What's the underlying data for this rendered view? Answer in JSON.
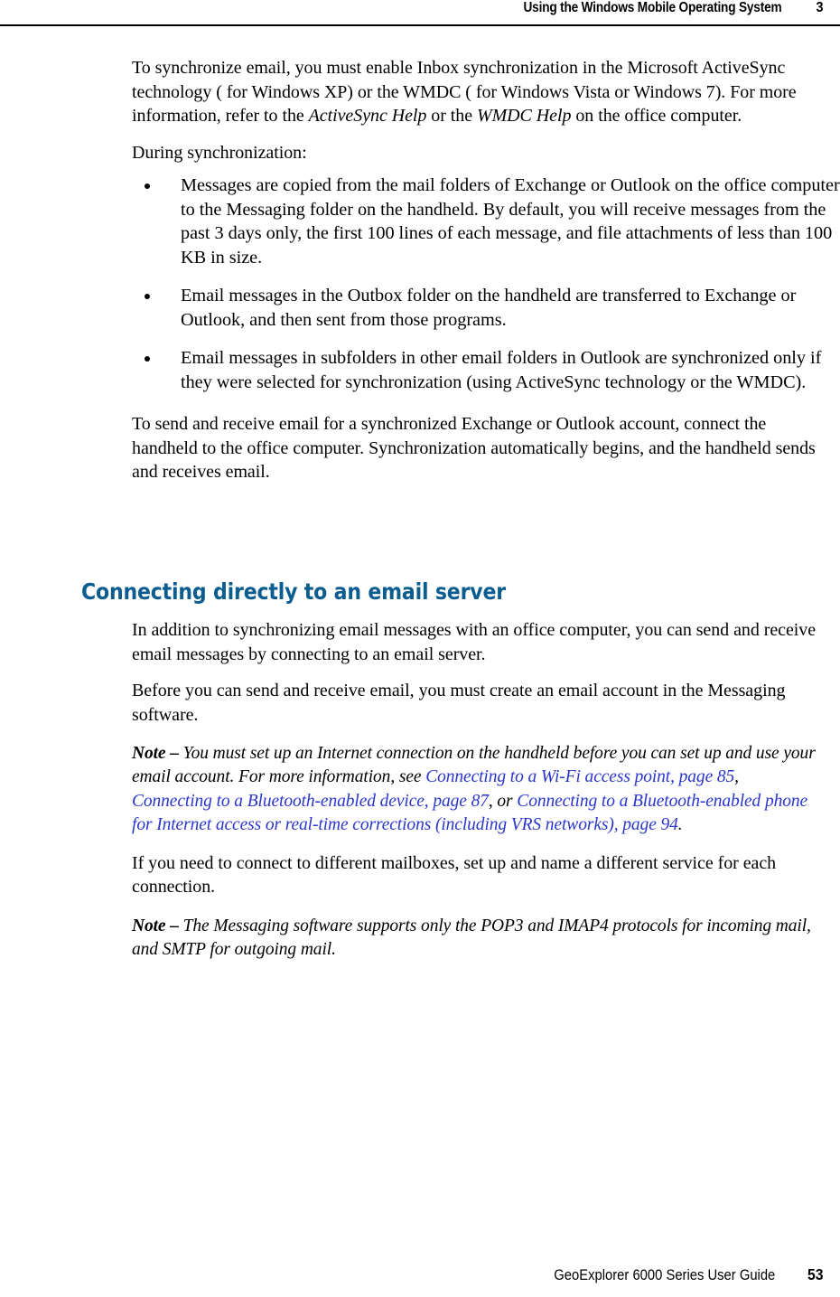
{
  "header": {
    "running_title": "Using the Windows Mobile Operating System",
    "chapter_number": "3"
  },
  "intro": {
    "paragraph_1_part_1": "To synchronize email, you must enable Inbox synchronization in the Microsoft ActiveSync technology ( for Windows XP) or the WMDC ( for Windows Vista or Windows 7). For more information, refer to the ",
    "paragraph_1_italic_1": "ActiveSync Help",
    "paragraph_1_part_2": " or the ",
    "paragraph_1_italic_2": "WMDC Help",
    "paragraph_1_part_3": " on the office computer.",
    "paragraph_2": "During synchronization:"
  },
  "bullets": [
    "Messages are copied from the mail folders of Exchange or Outlook on the office computer to the Messaging folder on the handheld. By default, you will receive messages from the past 3 days only, the first 100 lines of each message, and file attachments of less than 100 KB in size.",
    "Email messages in the Outbox folder on the handheld are transferred to Exchange or Outlook, and then sent from those programs.",
    "Email messages in subfolders in other email folders in Outlook are synchronized only if they were selected for synchronization (using ActiveSync technology or the WMDC)."
  ],
  "after_bullets": {
    "paragraph": "To send and receive email for a synchronized Exchange or Outlook account, connect the handheld to the office computer. Synchronization automatically begins, and the handheld sends and receives email."
  },
  "section": {
    "heading": "Connecting directly to an email server",
    "paragraph_1": "In addition to synchronizing email messages with an office computer, you can send and receive email messages by connecting to an email server.",
    "paragraph_2": "Before you can send and receive email, you must create an email account in the Messaging software."
  },
  "note_1": {
    "label": "Note –",
    "text_1": " You must set up an Internet connection on the handheld before you can set up and use your email account. For more information, see ",
    "xref_1": "Connecting to a Wi-Fi access point, page 85",
    "text_2": ", ",
    "xref_2": "Connecting to a Bluetooth-enabled device, page 87",
    "text_3": ", or ",
    "xref_3": "Connecting to a Bluetooth-enabled phone for Internet access or real-time corrections (including VRS networks), page 94",
    "text_4": "."
  },
  "mailboxes": {
    "paragraph": " If you need to connect to different mailboxes, set up and name a different service for each connection."
  },
  "note_2": {
    "label": "Note –",
    "text": " The Messaging software supports only the POP3 and IMAP4 protocols for incoming mail, and SMTP for outgoing mail."
  },
  "footer": {
    "guide_title": "GeoExplorer 6000 Series User Guide",
    "page_number": "53"
  },
  "colors": {
    "heading_blue": "#0b5d8f",
    "xref_blue": "#2a35cd",
    "rule_black": "#000000"
  }
}
